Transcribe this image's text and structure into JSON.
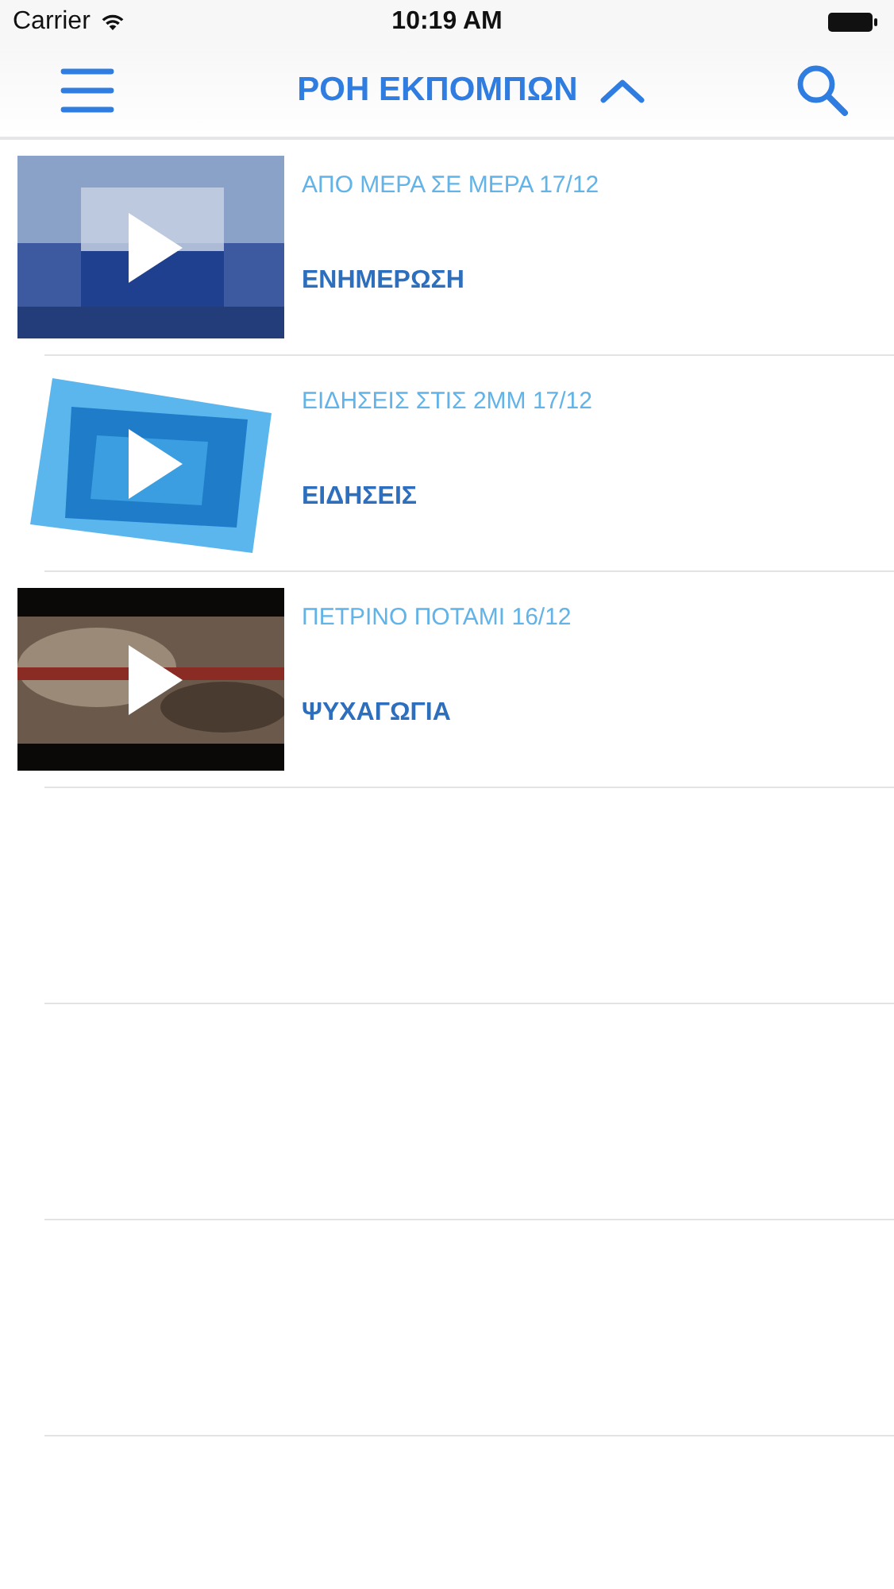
{
  "status_bar": {
    "carrier": "Carrier",
    "time": "10:19 AM"
  },
  "nav_bar": {
    "title": "ΡΟΗ ΕΚΠΟΜΠΩΝ",
    "expanded": true
  },
  "items": [
    {
      "title": "ΑΠΟ ΜΕΡΑ ΣΕ ΜΕΡΑ 17/12",
      "category": "ΕΝΗΜΕΡΩΣΗ",
      "kind": "picture"
    },
    {
      "title": "ΕΙΔΗΣΕΙΣ ΣΤΙΣ 2ΜΜ 17/12",
      "category": "ΕΙΔΗΣΕΙΣ",
      "kind": "picture"
    },
    {
      "title": "ΠΕΤΡΙΝΟ ΠΟΤΑΜΙ 16/12",
      "category": "ΨΥΧΑΓΩΓΙΑ",
      "kind": "picture"
    }
  ]
}
